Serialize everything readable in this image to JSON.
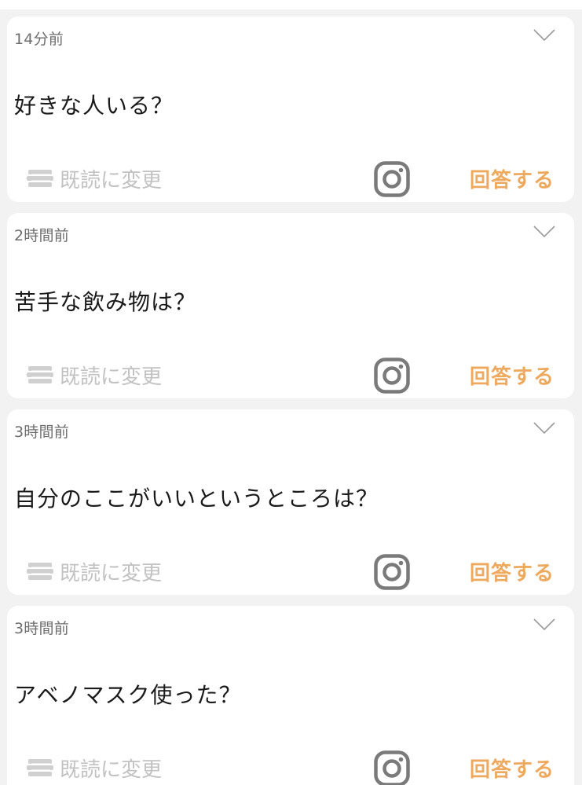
{
  "questions": [
    {
      "time": "14分前",
      "text": "好きな人いる？",
      "mark_read_label": "既読に変更",
      "answer_label": "回答する"
    },
    {
      "time": "2時間前",
      "text": "苦手な飲み物は？",
      "mark_read_label": "既読に変更",
      "answer_label": "回答する"
    },
    {
      "time": "3時間前",
      "text": "自分のここがいいというところは？",
      "mark_read_label": "既読に変更",
      "answer_label": "回答する"
    },
    {
      "time": "3時間前",
      "text": "アベノマスク使った？",
      "mark_read_label": "既読に変更",
      "answer_label": "回答する"
    }
  ],
  "icons": {
    "expand": "chevron-down-icon",
    "mark_read": "stack-icon",
    "share": "instagram-icon"
  },
  "colors": {
    "background": "#f2f2f2",
    "card": "#ffffff",
    "accent": "#eda95e",
    "muted_text": "#c2c2c2",
    "time_text": "#6e6e6e",
    "question_text": "#1a1a1a",
    "icon_gray": "#7a7a7a"
  }
}
